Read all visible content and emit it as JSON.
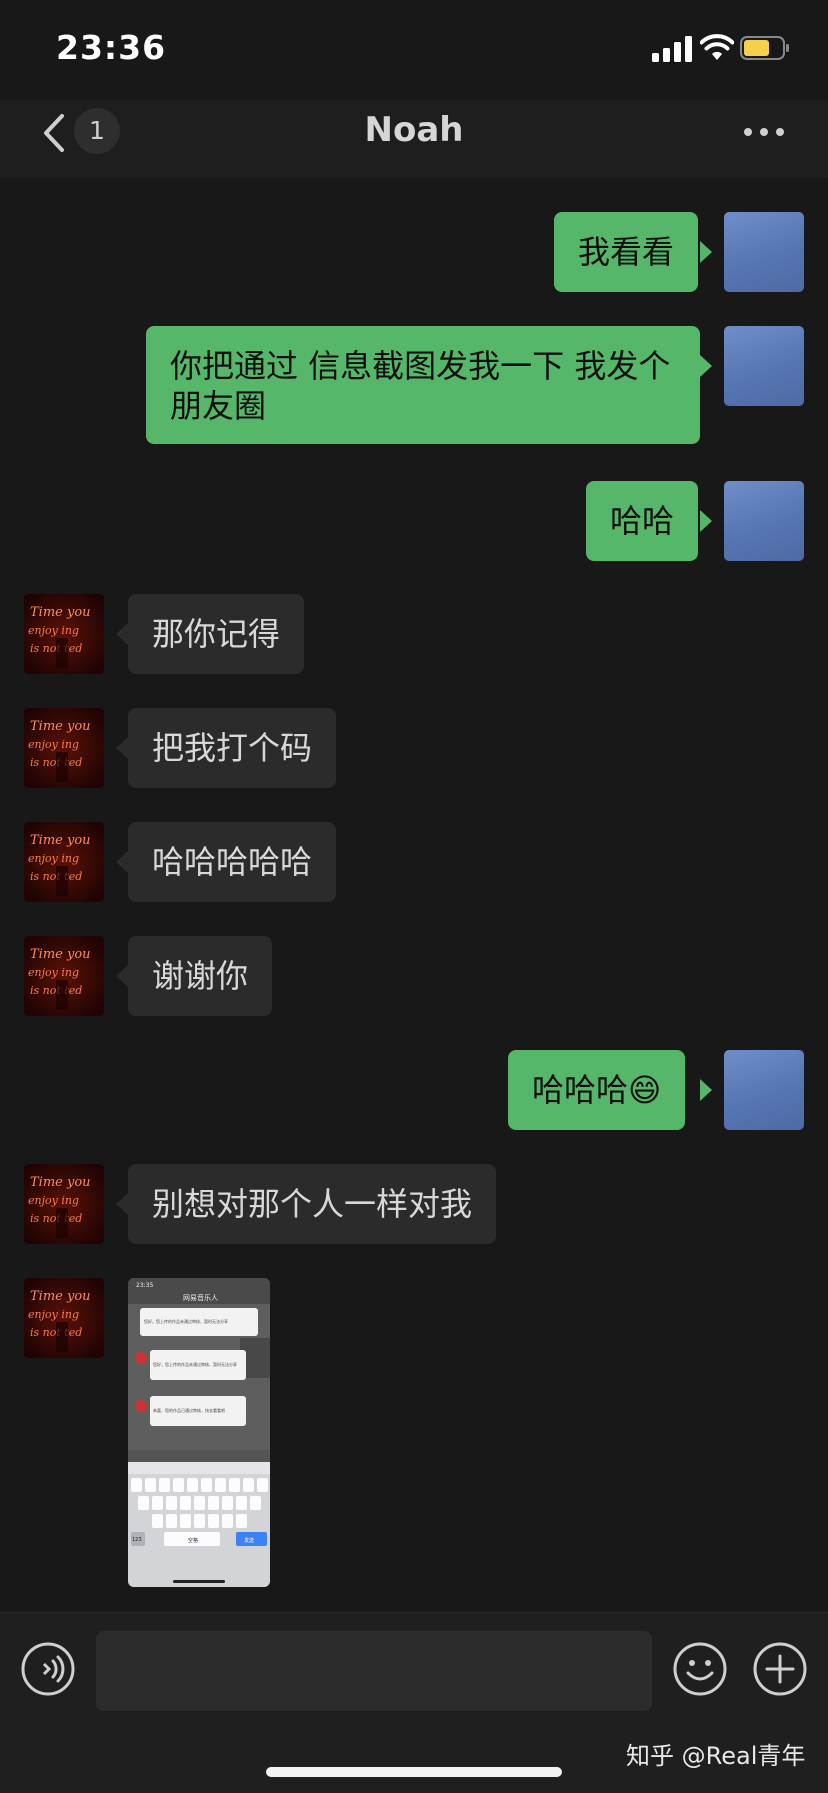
{
  "status_bar": {
    "time": "23:36",
    "battery_color": "#f5d04a"
  },
  "nav": {
    "back_count": "1",
    "title": "Noah"
  },
  "messages": [
    {
      "from": "me",
      "text": "我看看"
    },
    {
      "from": "me",
      "text": "你把通过 信息截图发我一下 我发个朋友圈"
    },
    {
      "from": "me",
      "text": "哈哈"
    },
    {
      "from": "them",
      "text": "那你记得"
    },
    {
      "from": "them",
      "text": "把我打个码"
    },
    {
      "from": "them",
      "text": "哈哈哈哈哈"
    },
    {
      "from": "them",
      "text": "谢谢你"
    },
    {
      "from": "me",
      "text": "哈哈哈😄"
    },
    {
      "from": "them",
      "text": "别想对那个人一样对我"
    },
    {
      "from": "them",
      "type": "image",
      "text": ""
    }
  ],
  "contact_avatar": {
    "neon_text": [
      "Time you",
      "enjoy  ing",
      "is not  ted"
    ]
  },
  "thumbnail": {
    "time": "23:35",
    "title": "网易音乐人",
    "msg1": "您好，您上传的作品未通过审核，暂时无法分享",
    "msg2": "恭喜，您的作品已通过审核，快去看看吧",
    "keys_row1": [
      "q",
      "w",
      "e",
      "r",
      "t",
      "y",
      "u",
      "i",
      "o",
      "p"
    ],
    "keys_row2": [
      "a",
      "s",
      "d",
      "f",
      "g",
      "h",
      "j",
      "k",
      "l"
    ],
    "keys_row3": [
      "z",
      "x",
      "c",
      "v",
      "b",
      "n",
      "m"
    ],
    "space": "空格",
    "send": "发送",
    "num": "123"
  },
  "input": {
    "placeholder": ""
  },
  "watermark": "知乎 @Real青年",
  "colors": {
    "outgoing_bubble": "#56b66a",
    "incoming_bubble": "#2b2b2b",
    "background": "#181818"
  }
}
